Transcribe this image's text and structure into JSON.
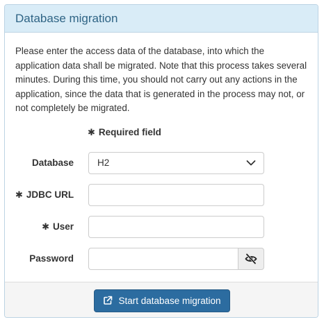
{
  "panel": {
    "title": "Database migration",
    "intro": "Please enter the access data of the database, into which the application data shall be migrated. Note that this process takes several minutes. During this time, you should not carry out any actions in the application, since the data that is generated in the process may not, or not completely be migrated."
  },
  "form": {
    "required_note": "Required field",
    "required_symbol": "✱",
    "database": {
      "label": "Database",
      "selected": "H2"
    },
    "jdbc_url": {
      "label": "JDBC URL",
      "value": "",
      "required": true
    },
    "user": {
      "label": "User",
      "value": "",
      "required": true
    },
    "password": {
      "label": "Password",
      "value": "",
      "toggle_icon": "eye-slash-icon"
    }
  },
  "footer": {
    "submit_label": "Start database migration",
    "submit_icon": "external-link-icon"
  },
  "colors": {
    "heading_bg": "#d9ecf7",
    "heading_text": "#2f6485",
    "primary_button": "#2c6ca0"
  }
}
